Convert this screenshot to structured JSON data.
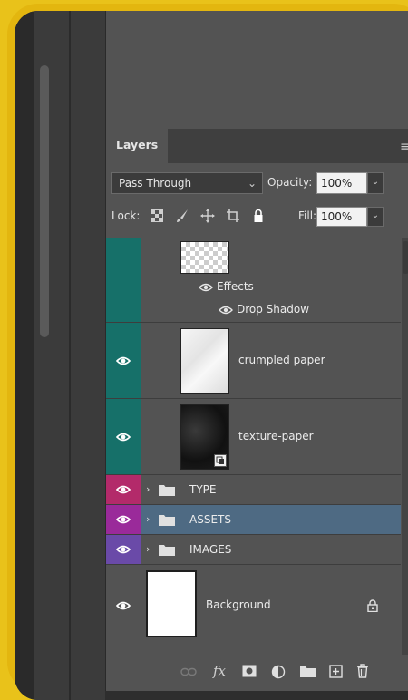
{
  "panel": {
    "tab_label": "Layers",
    "blend_mode": "Pass Through",
    "opacity_label": "Opacity:",
    "opacity_value": "100%",
    "lock_label": "Lock:",
    "fill_label": "Fill:",
    "fill_value": "100%"
  },
  "effects": {
    "effects_label": "Effects",
    "drop_shadow_label": "Drop Shadow"
  },
  "layers": [
    {
      "name": "crumpled paper",
      "kind": "layer",
      "eye_color": "#167069"
    },
    {
      "name": "texture-paper",
      "kind": "layer",
      "eye_color": "#167069"
    },
    {
      "name": "TYPE",
      "kind": "group",
      "eye_color": "#b32a6a"
    },
    {
      "name": "ASSETS",
      "kind": "group",
      "eye_color": "#9a2a9a",
      "selected": true
    },
    {
      "name": "IMAGES",
      "kind": "group",
      "eye_color": "#6a4aa8"
    },
    {
      "name": "Background",
      "kind": "background",
      "locked": true
    }
  ],
  "colors": {
    "panel_bg": "#535353",
    "selected_row": "#4e6a83",
    "frame": "#e3b60f"
  }
}
